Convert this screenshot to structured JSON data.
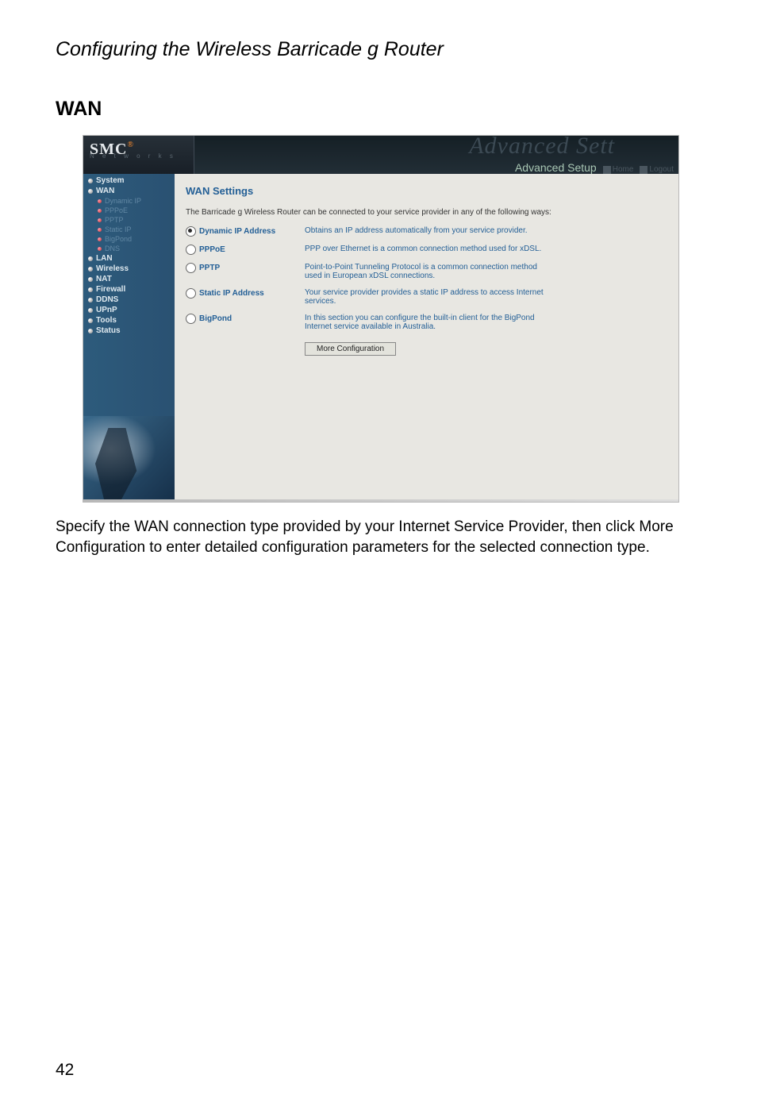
{
  "document": {
    "chapter_title": "Configuring the Wireless Barricade g Router",
    "section_title": "WAN",
    "description": "Specify the WAN connection type provided by your Internet Service Provider, then click More Configuration to enter detailed configuration parameters for the selected connection type.",
    "page_number": "42"
  },
  "screenshot": {
    "brand": {
      "logo_main": "SMC",
      "logo_sup": "®",
      "logo_sub": "N e t w o r k s"
    },
    "header": {
      "watermark": "Advanced Sett",
      "advanced_label": "Advanced Setup",
      "home_label": "Home",
      "logout_label": "Logout"
    },
    "sidebar": {
      "items": [
        {
          "label": "System",
          "type": "main"
        },
        {
          "label": "WAN",
          "type": "main"
        },
        {
          "label": "Dynamic IP",
          "type": "sub"
        },
        {
          "label": "PPPoE",
          "type": "sub"
        },
        {
          "label": "PPTP",
          "type": "sub"
        },
        {
          "label": "Static IP",
          "type": "sub"
        },
        {
          "label": "BigPond",
          "type": "sub"
        },
        {
          "label": "DNS",
          "type": "sub"
        },
        {
          "label": "LAN",
          "type": "main"
        },
        {
          "label": "Wireless",
          "type": "main"
        },
        {
          "label": "NAT",
          "type": "main"
        },
        {
          "label": "Firewall",
          "type": "main"
        },
        {
          "label": "DDNS",
          "type": "main"
        },
        {
          "label": "UPnP",
          "type": "main"
        },
        {
          "label": "Tools",
          "type": "main"
        },
        {
          "label": "Status",
          "type": "main"
        }
      ]
    },
    "content": {
      "title": "WAN Settings",
      "intro": "The Barricade g Wireless Router can be connected to your service provider in any of the following ways:",
      "options": [
        {
          "label": "Dynamic IP Address",
          "desc": "Obtains an IP address automatically from your service provider.",
          "checked": true
        },
        {
          "label": "PPPoE",
          "desc": "PPP over Ethernet is a common connection method used for xDSL.",
          "checked": false
        },
        {
          "label": "PPTP",
          "desc": "Point-to-Point Tunneling Protocol is a common connection method used in European xDSL connections.",
          "checked": false
        },
        {
          "label": "Static IP Address",
          "desc": "Your service provider provides a static IP address to access Internet services.",
          "checked": false
        },
        {
          "label": "BigPond",
          "desc": "In this section you can configure the built-in client for the BigPond Internet service available in Australia.",
          "checked": false
        }
      ],
      "button": "More Configuration"
    }
  }
}
